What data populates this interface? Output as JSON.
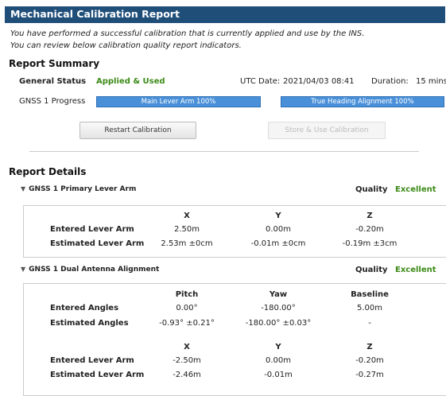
{
  "title": "Mechanical Calibration Report",
  "intro": {
    "line1": "You have performed a successful calibration that is currently applied and use by the INS.",
    "line2": "You can review below calibration quality report indicators."
  },
  "summary": {
    "heading": "Report Summary",
    "general_status_label": "General Status",
    "general_status_value": "Applied & Used",
    "utc_label": "UTC Date:",
    "utc_value": "2021/04/03 08:41",
    "duration_label": "Duration:",
    "duration_value": "15 mins",
    "gnss_progress_label": "GNSS 1 Progress",
    "progress": [
      {
        "label": "Main Lever Arm 100%",
        "value": 100
      },
      {
        "label": "True Heading Alignment 100%",
        "value": 100
      }
    ],
    "restart_button": "Restart Calibration",
    "store_button": "Store & Use Calibration"
  },
  "details": {
    "heading": "Report Details",
    "primary": {
      "title": "GNSS 1 Primary Lever Arm",
      "quality_label": "Quality",
      "quality_value": "Excellent",
      "headers": [
        "X",
        "Y",
        "Z"
      ],
      "rows": [
        {
          "label": "Entered Lever Arm",
          "values": [
            "2.50m",
            "0.00m",
            "-0.20m"
          ]
        },
        {
          "label": "Estimated Lever Arm",
          "values": [
            "2.53m ±0cm",
            "-0.01m ±0cm",
            "-0.19m ±3cm"
          ]
        }
      ]
    },
    "dual": {
      "title": "GNSS 1 Dual Antenna Alignment",
      "quality_label": "Quality",
      "quality_value": "Excellent",
      "angle_headers": [
        "Pitch",
        "Yaw",
        "Baseline"
      ],
      "angle_rows": [
        {
          "label": "Entered Angles",
          "values": [
            "0.00°",
            "-180.00°",
            "5.00m"
          ]
        },
        {
          "label": "Estimated Angles",
          "values": [
            "-0.93° ±0.21°",
            "-180.00° ±0.03°",
            "-"
          ]
        }
      ],
      "arm_headers": [
        "X",
        "Y",
        "Z"
      ],
      "arm_rows": [
        {
          "label": "Entered Lever Arm",
          "values": [
            "-2.50m",
            "0.00m",
            "-0.20m"
          ]
        },
        {
          "label": "Estimated Lever Arm",
          "values": [
            "-2.46m",
            "-0.01m",
            "-0.27m"
          ]
        }
      ]
    }
  }
}
